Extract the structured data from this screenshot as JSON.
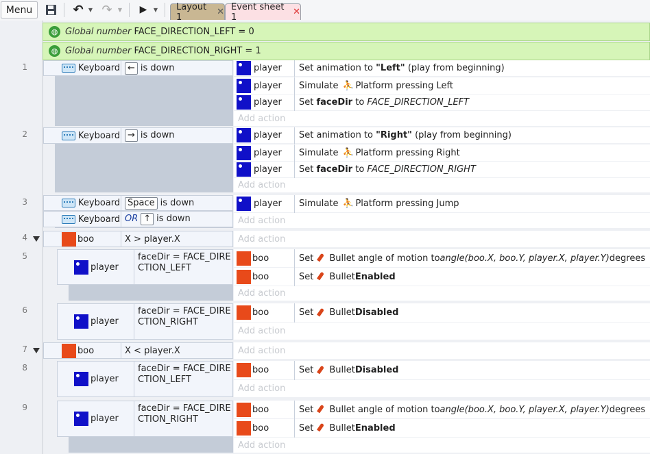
{
  "toolbar": {
    "menu_label": "Menu",
    "tabs": [
      {
        "label": "Layout 1"
      },
      {
        "label": "Event sheet 1"
      }
    ]
  },
  "colors": {
    "global_var_bg": "#d6f5b8",
    "event_tab_bg": "#fce0e4",
    "layout_tab_bg": "#c9b793",
    "player_sprite": "#1010c8",
    "boo_sprite": "#e84a1a"
  },
  "globals": [
    {
      "prefix": "Global number",
      "name": "FACE_DIRECTION_LEFT",
      "eq": "= 0"
    },
    {
      "prefix": "Global number",
      "name": "FACE_DIRECTION_RIGHT",
      "eq": "= 1"
    }
  ],
  "events": [
    {
      "num": "1",
      "obj": "Keyboard",
      "key": "←",
      "cond": "is down",
      "actions": [
        {
          "obj": "player",
          "pre": "Set animation to ",
          "bold": "\"Left\"",
          "post": " (play from beginning)"
        },
        {
          "obj": "player",
          "pre": "Simulate",
          "beh": "Platform pressing Left"
        },
        {
          "obj": "player",
          "pre": "Set ",
          "bold": "faceDir",
          "mid": " to ",
          "ital": "FACE_DIRECTION_LEFT"
        }
      ]
    },
    {
      "num": "2",
      "obj": "Keyboard",
      "key": "→",
      "cond": "is down",
      "actions": [
        {
          "obj": "player",
          "pre": "Set animation to ",
          "bold": "\"Right\"",
          "post": " (play from beginning)"
        },
        {
          "obj": "player",
          "pre": "Simulate",
          "beh": "Platform pressing Right"
        },
        {
          "obj": "player",
          "pre": "Set ",
          "bold": "faceDir",
          "mid": " to ",
          "ital": "FACE_DIRECTION_RIGHT"
        }
      ]
    },
    {
      "num": "3",
      "obj": "Keyboard",
      "key": "Space",
      "cond": "is down",
      "or_label": "OR",
      "key2": "↑",
      "cond2": "is down",
      "actions": [
        {
          "obj": "player",
          "pre": "Simulate",
          "beh": "Platform pressing Jump"
        }
      ]
    },
    {
      "num": "4",
      "obj": "boo",
      "cond": "X > player.X"
    },
    {
      "num": "5",
      "obj": "player",
      "cond": "faceDir = FACE_DIRECTION_LEFT",
      "actions": [
        {
          "obj": "boo",
          "pre": "Set",
          "beh": "Bullet angle of motion to ",
          "ital": "angle(boo.X, boo.Y, player.X, player.Y)",
          "post": " degrees"
        },
        {
          "obj": "boo",
          "pre": "Set",
          "beh": "Bullet ",
          "bold": "Enabled"
        }
      ]
    },
    {
      "num": "6",
      "obj": "player",
      "cond": "faceDir = FACE_DIRECTION_RIGHT",
      "actions": [
        {
          "obj": "boo",
          "pre": "Set",
          "beh": "Bullet ",
          "bold": "Disabled"
        }
      ]
    },
    {
      "num": "7",
      "obj": "boo",
      "cond": "X < player.X"
    },
    {
      "num": "8",
      "obj": "player",
      "cond": "faceDir = FACE_DIRECTION_LEFT",
      "actions": [
        {
          "obj": "boo",
          "pre": "Set",
          "beh": "Bullet ",
          "bold": "Disabled"
        }
      ]
    },
    {
      "num": "9",
      "obj": "player",
      "cond": "faceDir = FACE_DIRECTION_RIGHT",
      "actions": [
        {
          "obj": "boo",
          "pre": "Set",
          "beh": "Bullet angle of motion to ",
          "ital": "angle(boo.X, boo.Y, player.X, player.Y)",
          "post": " degrees"
        },
        {
          "obj": "boo",
          "pre": "Set",
          "beh": "Bullet ",
          "bold": "Enabled"
        }
      ]
    }
  ],
  "add_action_label": "Add action"
}
